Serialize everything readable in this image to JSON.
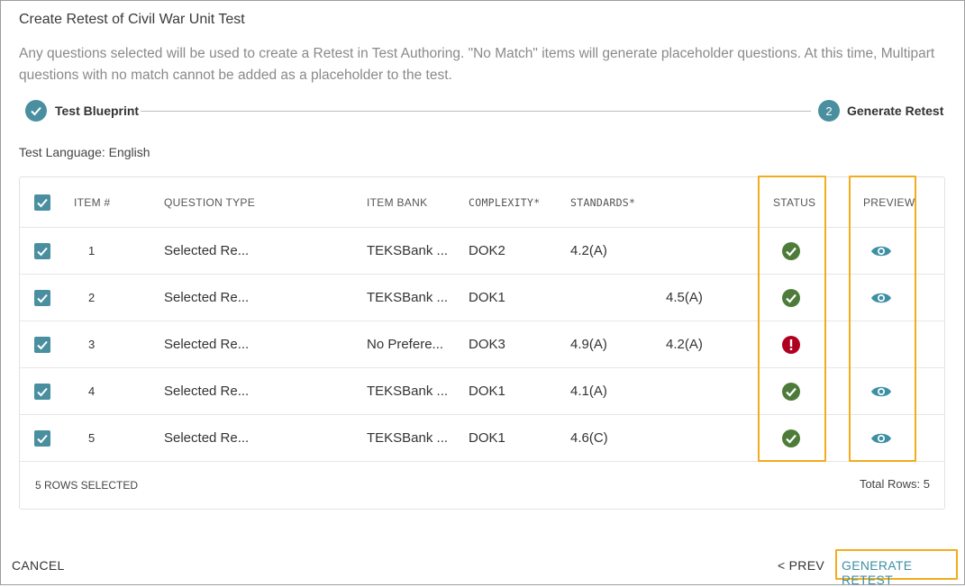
{
  "dialog": {
    "title": "Create Retest of Civil War Unit Test",
    "description": "Any questions selected will be used to create a Retest in Test Authoring. \"No Match\" items will generate placeholder questions. At this time, Multipart questions with no match cannot be added as a placeholder to the test."
  },
  "stepper": {
    "step1": {
      "label": "Test Blueprint",
      "state": "complete"
    },
    "step2": {
      "number": "2",
      "label": "Generate Retest",
      "state": "active"
    }
  },
  "test_language": "Test Language: English",
  "table": {
    "headers": {
      "item": "ITEM #",
      "question_type": "QUESTION TYPE",
      "item_bank": "ITEM BANK",
      "complexity": "COMPLEXITY*",
      "standards": "STANDARDS*",
      "status": "STATUS",
      "preview": "PREVIEW"
    },
    "rows": [
      {
        "item": "1",
        "question_type": "Selected Re...",
        "item_bank": "TEKSBank ...",
        "complexity": "DOK2",
        "standard_a": "4.2(A)",
        "standard_b": "",
        "status": "match",
        "preview": true
      },
      {
        "item": "2",
        "question_type": "Selected Re...",
        "item_bank": "TEKSBank ...",
        "complexity": "DOK1",
        "standard_a": "",
        "standard_b": "4.5(A)",
        "status": "match",
        "preview": true
      },
      {
        "item": "3",
        "question_type": "Selected Re...",
        "item_bank": "No Prefere...",
        "complexity": "DOK3",
        "standard_a": "4.9(A)",
        "standard_b": "4.2(A)",
        "status": "no-match",
        "preview": false
      },
      {
        "item": "4",
        "question_type": "Selected Re...",
        "item_bank": "TEKSBank ...",
        "complexity": "DOK1",
        "standard_a": "4.1(A)",
        "standard_b": "",
        "status": "match",
        "preview": true
      },
      {
        "item": "5",
        "question_type": "Selected Re...",
        "item_bank": "TEKSBank ...",
        "complexity": "DOK1",
        "standard_a": "4.6(C)",
        "standard_b": "",
        "status": "match",
        "preview": true
      }
    ],
    "footer": {
      "selected": "5 ROWS SELECTED",
      "total": "Total Rows: 5"
    }
  },
  "actions": {
    "cancel": "CANCEL",
    "prev": "< PREV",
    "generate": "GENERATE RETEST"
  },
  "icons": {
    "check": "checkmark-icon",
    "status_ok": "check-circle-icon",
    "status_error": "exclamation-circle-icon",
    "preview": "eye-icon"
  },
  "colors": {
    "accent": "#4a8fa0",
    "success": "#4d7c3a",
    "error": "#b00020",
    "highlight": "#f2ac1c",
    "generate_text": "#3e8fa3"
  }
}
